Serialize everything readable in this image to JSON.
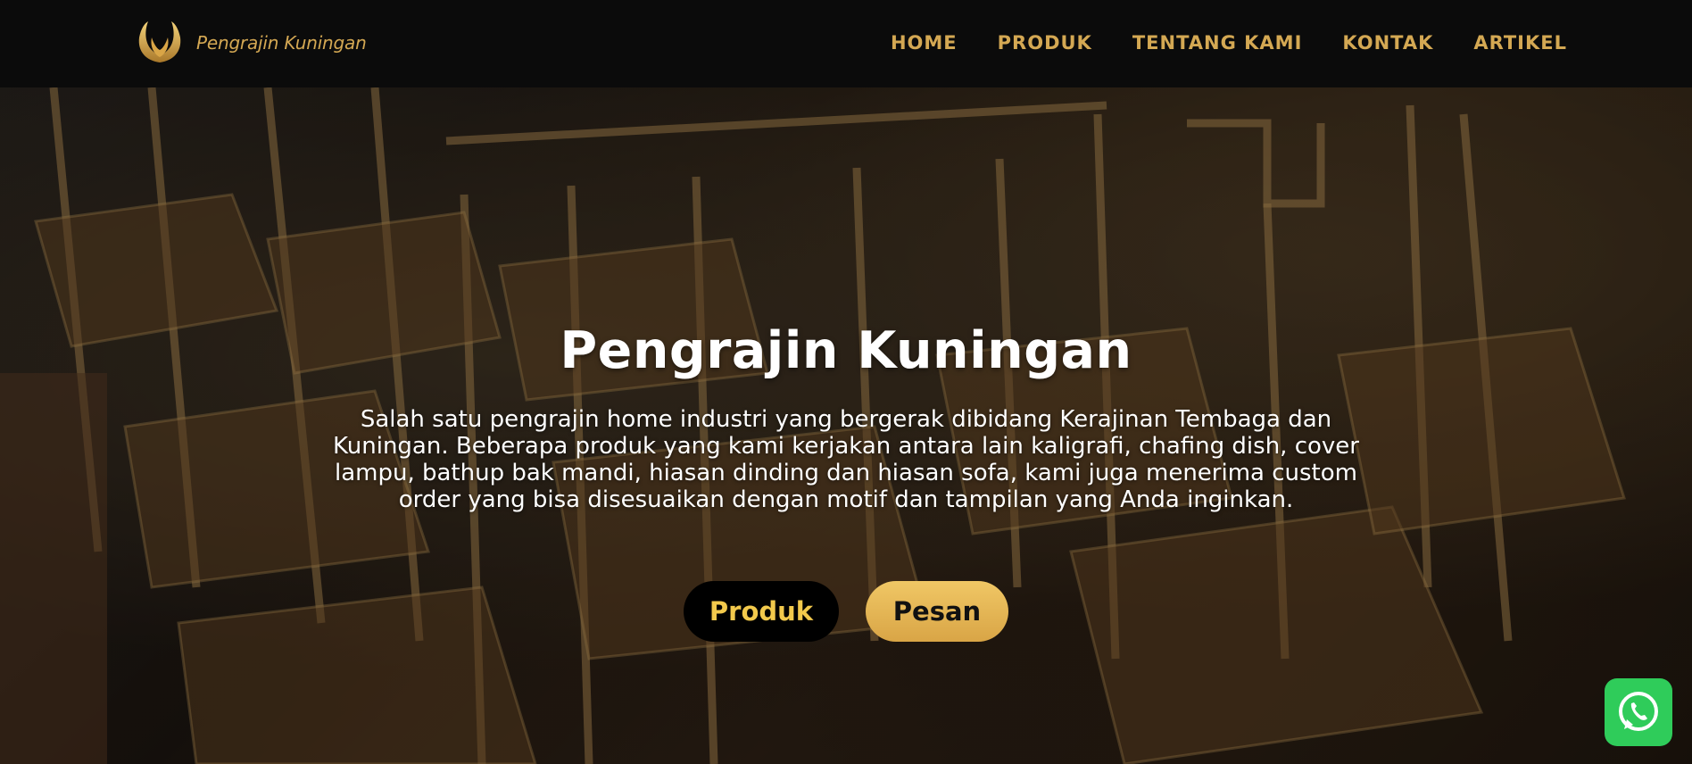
{
  "brand": {
    "name": "Pengrajin Kuningan",
    "logo_icon": "golden-wings-logo-icon",
    "accent_color": "#d4a853"
  },
  "nav": {
    "items": [
      {
        "label": "HOME"
      },
      {
        "label": "PRODUK"
      },
      {
        "label": "TENTANG KAMI"
      },
      {
        "label": "KONTAK"
      },
      {
        "label": "ARTIKEL"
      }
    ]
  },
  "hero": {
    "title": "Pengrajin Kuningan",
    "description": "Salah satu pengrajin home industri yang bergerak dibidang Kerajinan Tembaga dan Kuningan. Beberapa produk yang kami kerjakan antara lain kaligrafi, chafing dish, cover lampu, bathup bak mandi, hiasan dinding dan hiasan sofa, kami juga menerima custom order yang bisa disesuaikan dengan motif dan tampilan yang Anda inginkan.",
    "background_subject": "brass-crafted-ornamental-boxes-photo",
    "buttons": {
      "primary_label": "Produk",
      "secondary_label": "Pesan"
    }
  },
  "floating": {
    "whatsapp_icon": "whatsapp-icon",
    "whatsapp_color": "#2fcc5a"
  }
}
